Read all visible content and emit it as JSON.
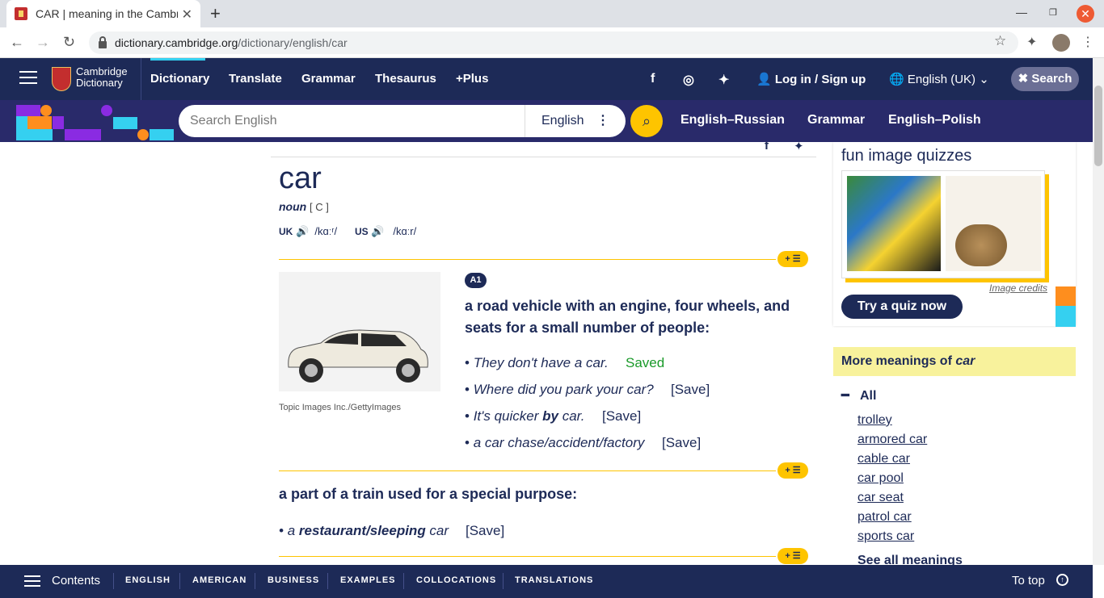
{
  "browser": {
    "tab_title": "CAR | meaning in the Cambridge English Dictionary",
    "url_host": "dictionary.cambridge.org",
    "url_path": "/dictionary/english/car"
  },
  "site": {
    "logo_line1": "Cambridge",
    "logo_line2": "Dictionary",
    "nav": [
      "Dictionary",
      "Translate",
      "Grammar",
      "Thesaurus",
      "+Plus"
    ],
    "login": "Log in / Sign up",
    "language": "English (UK)",
    "search_button": "Search"
  },
  "search": {
    "placeholder": "Search English",
    "dictionary": "English",
    "quick_links": [
      "English–Russian",
      "Grammar",
      "English–Polish"
    ]
  },
  "entry": {
    "headword": "car",
    "pos": "noun",
    "grammar": "[ C ]",
    "uk_label": "UK",
    "uk_ipa": "/kɑːʳ/",
    "us_label": "US",
    "us_ipa": "/kɑːr/",
    "image_credit": "Topic Images Inc./GettyImages",
    "sense1": {
      "level": "A1",
      "definition": "a road vehicle with an engine, four wheels, and seats for a small number of people:",
      "examples": [
        {
          "pre": "They don't have a car.",
          "bold": "",
          "post": "",
          "save": "Saved"
        },
        {
          "pre": "Where did you park your car?",
          "bold": "",
          "post": "",
          "save": "[Save]"
        },
        {
          "pre": "It's quicker ",
          "bold": "by",
          "post": " car.",
          "save": "[Save]"
        },
        {
          "pre": "a car chase/accident/factory",
          "bold": "",
          "post": "",
          "save": "[Save]"
        }
      ]
    },
    "sense2": {
      "definition": "a part of a train used for a special purpose:",
      "example_pre": "a ",
      "example_bold": "restaurant/sleeping",
      "example_post": " car",
      "save": "[Save]"
    }
  },
  "sidebar": {
    "quiz_title": "fun image quizzes",
    "image_credits": "Image credits",
    "quiz_button": "Try a quiz now",
    "more_meanings_prefix": "More meanings of ",
    "more_meanings_word": "car",
    "all_label": "All",
    "links": [
      "trolley",
      "armored car",
      "cable car",
      "car pool",
      "car seat",
      "patrol car",
      "sports car"
    ],
    "see_all": "See all meanings"
  },
  "bottom": {
    "contents": "Contents",
    "tabs": [
      "ENGLISH",
      "AMERICAN",
      "BUSINESS",
      "EXAMPLES",
      "COLLOCATIONS",
      "TRANSLATIONS"
    ],
    "to_top": "To top"
  },
  "colors": {
    "brand": "#1d2a57",
    "accent_yellow": "#fec400",
    "saved_green": "#1a9a2a"
  }
}
